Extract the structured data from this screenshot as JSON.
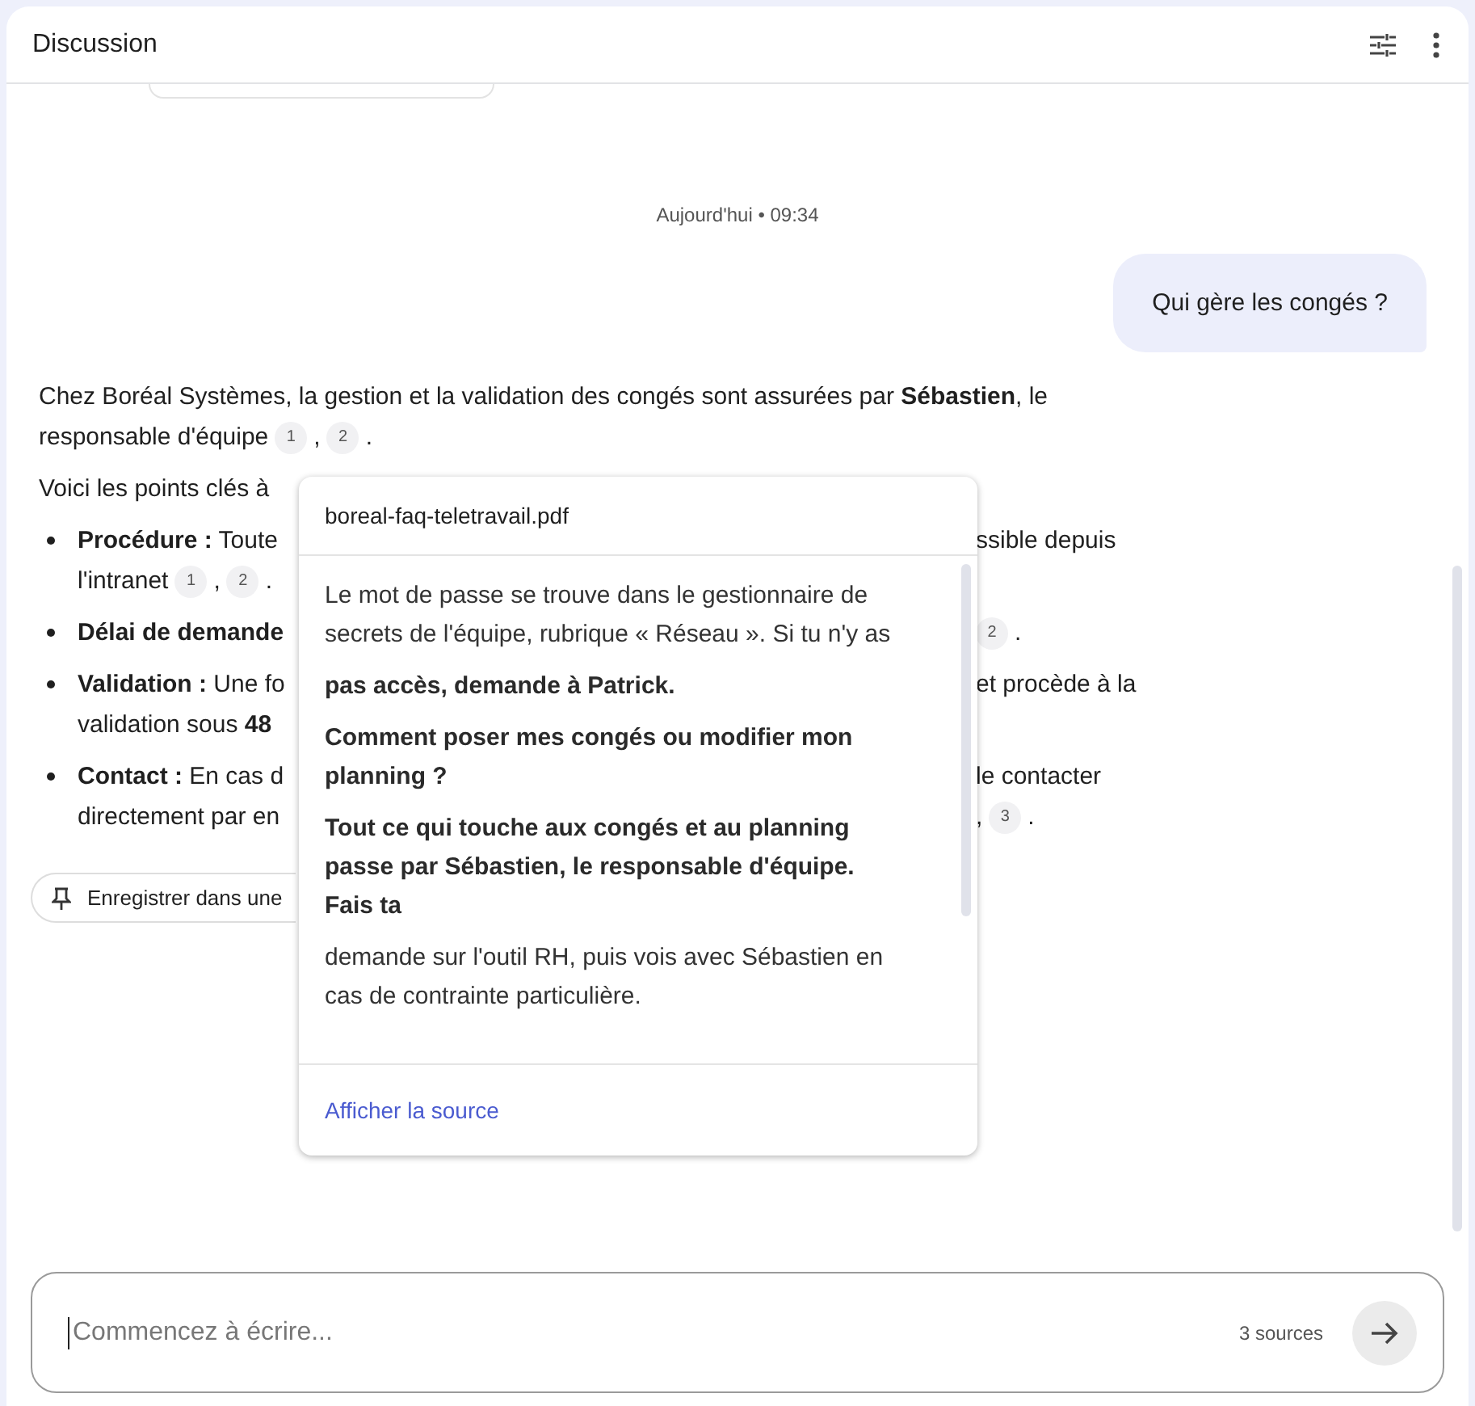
{
  "header": {
    "title": "Discussion"
  },
  "timestamp": "Aujourd'hui • 09:34",
  "user_message": "Qui gère les congés ?",
  "answer_lines": [
    {
      "kind": "para",
      "left": [
        {
          "kind": "text",
          "text": "Chez Boréal Systèmes, la gestion et la validation des congés sont assurées par **Sébastien**, le"
        }
      ]
    },
    {
      "kind": "cont_para",
      "left": [
        {
          "kind": "text",
          "text": "responsable d'équipe"
        },
        {
          "kind": "cite",
          "text": "1"
        },
        {
          "kind": "text",
          "text": ","
        },
        {
          "kind": "cite",
          "text": "2"
        },
        {
          "kind": "text",
          "text": "."
        }
      ]
    },
    {
      "kind": "para",
      "left": [
        {
          "kind": "text",
          "text": "Voici les points clés à"
        }
      ]
    },
    {
      "kind": "bullet",
      "left": [
        {
          "kind": "text",
          "text": "**Procédure :** Toute"
        }
      ],
      "right": [
        {
          "kind": "text",
          "text": "ssible depuis"
        }
      ]
    },
    {
      "kind": "cont",
      "left": [
        {
          "kind": "text",
          "text": "l'intranet"
        },
        {
          "kind": "cite",
          "text": "1"
        },
        {
          "kind": "text",
          "text": ","
        },
        {
          "kind": "cite",
          "text": "2"
        },
        {
          "kind": "text",
          "text": "."
        }
      ]
    },
    {
      "kind": "bullet",
      "left": [
        {
          "kind": "text",
          "text": "**Délai de demande**"
        }
      ],
      "right": [
        {
          "kind": "cite",
          "text": "2"
        },
        {
          "kind": "text",
          "text": "."
        }
      ]
    },
    {
      "kind": "bullet",
      "left": [
        {
          "kind": "text",
          "text": "**Validation :** Une fo"
        }
      ],
      "right": [
        {
          "kind": "text",
          "text": "et procède à la"
        }
      ]
    },
    {
      "kind": "cont",
      "left": [
        {
          "kind": "text",
          "text": "validation sous **48**"
        }
      ]
    },
    {
      "kind": "bullet",
      "left": [
        {
          "kind": "text",
          "text": "**Contact :** En cas d"
        }
      ],
      "right": [
        {
          "kind": "text",
          "text": "le contacter"
        }
      ]
    },
    {
      "kind": "cont",
      "left": [
        {
          "kind": "text",
          "text": "directement par en"
        }
      ],
      "right": [
        {
          "kind": "text",
          "text": ","
        },
        {
          "kind": "cite",
          "text": "3"
        },
        {
          "kind": "text",
          "text": "."
        }
      ]
    }
  ],
  "pin_button": {
    "label": "Enregistrer dans une"
  },
  "source_popup": {
    "file": "boreal-faq-teletravail.pdf",
    "paragraphs": [
      {
        "text": "Le mot de passe se trouve dans le gestionnaire de secrets de l'équipe, rubrique « Réseau ». Si tu n'y as",
        "bold": false
      },
      {
        "text": "pas accès, demande à Patrick.",
        "bold": true
      },
      {
        "text": "Comment poser mes congés ou modifier mon planning ?",
        "bold": true
      },
      {
        "text": "Tout ce qui touche aux congés et au planning passe par Sébastien, le responsable d'équipe. Fais ta",
        "bold": true
      },
      {
        "text": "demande sur l'outil RH, puis vois avec Sébastien en cas de contrainte particulière.",
        "bold": false
      }
    ],
    "link": "Afficher la source"
  },
  "composer": {
    "placeholder": "Commencez à écrire...",
    "sources": "3 sources"
  }
}
